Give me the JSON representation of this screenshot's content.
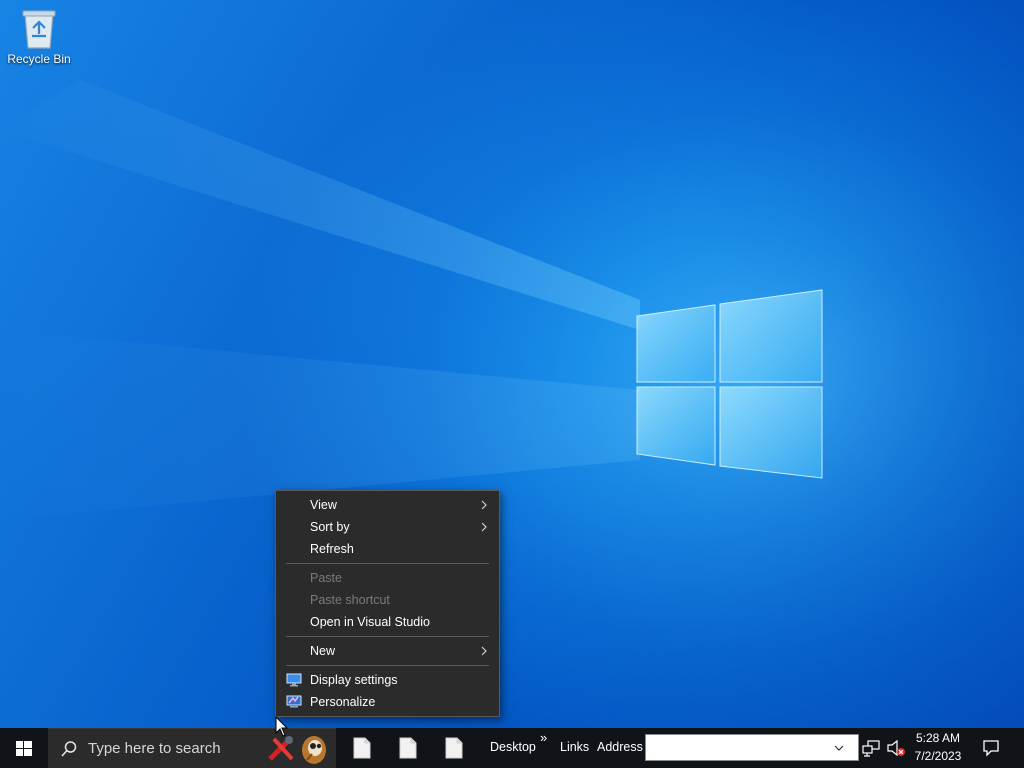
{
  "desktop": {
    "icons": [
      {
        "label": "Recycle Bin"
      }
    ]
  },
  "context_menu": {
    "items": [
      {
        "label": "View",
        "submenu": true,
        "enabled": true
      },
      {
        "label": "Sort by",
        "submenu": true,
        "enabled": true
      },
      {
        "label": "Refresh",
        "submenu": false,
        "enabled": true
      },
      {
        "label": "Paste",
        "submenu": false,
        "enabled": false
      },
      {
        "label": "Paste shortcut",
        "submenu": false,
        "enabled": false
      },
      {
        "label": "Open in Visual Studio",
        "submenu": false,
        "enabled": true
      },
      {
        "label": "New",
        "submenu": true,
        "enabled": true
      },
      {
        "label": "Display settings",
        "icon": "display-icon",
        "enabled": true
      },
      {
        "label": "Personalize",
        "icon": "personalize-icon",
        "enabled": true
      }
    ]
  },
  "taskbar": {
    "search_placeholder": "Type here to search",
    "pinned_apps": [
      "tool-app-icon",
      "fox-app-icon"
    ],
    "open_windows": [
      "document-icon",
      "document-icon",
      "document-icon"
    ],
    "toolbars": {
      "desktop_label": "Desktop",
      "overflow_glyph": "»",
      "links_label": "Links",
      "address_label": "Address",
      "address_value": ""
    },
    "tray": {
      "network_icon": "network-icon",
      "volume_icon": "volume-muted-icon"
    },
    "clock": {
      "time": "5:28 AM",
      "date": "7/2/2023"
    }
  },
  "colors": {
    "taskbar_bg": "#101418",
    "menu_bg": "#2b2b2b",
    "menu_disabled_text": "#7a7a7a",
    "desktop_blue": "#0a6fd6"
  }
}
